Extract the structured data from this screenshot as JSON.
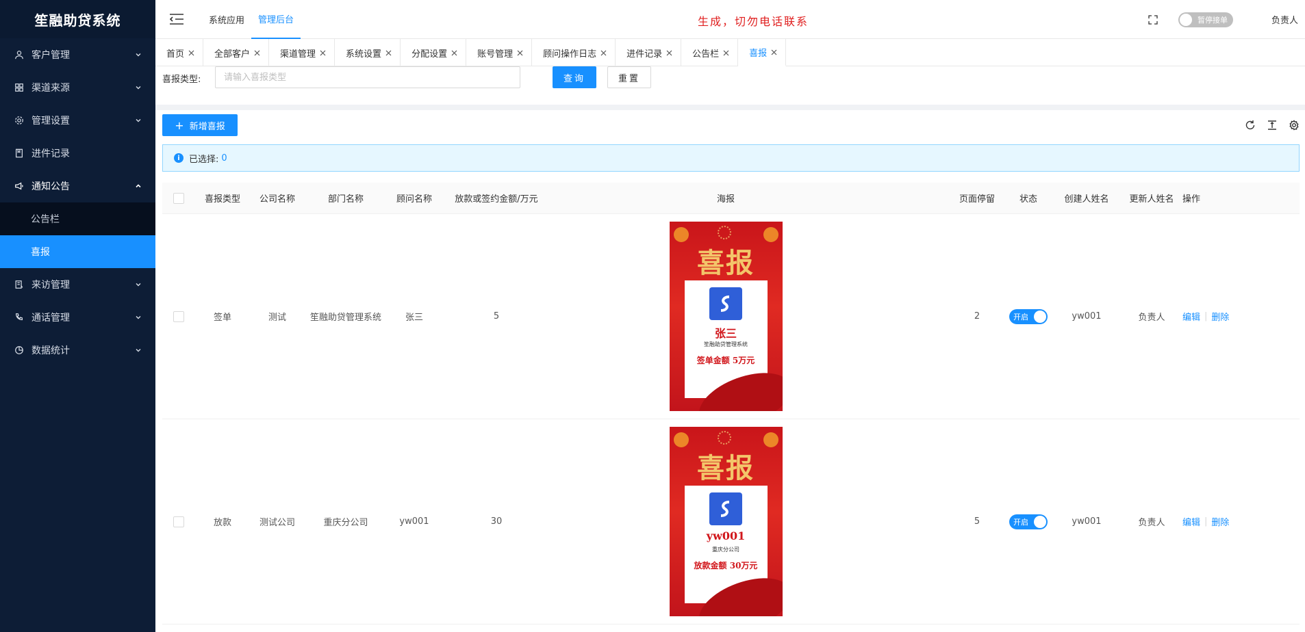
{
  "app": {
    "title": "笙融助贷系统"
  },
  "sidebar": {
    "items": [
      {
        "label": "客户管理",
        "icon": "user-icon",
        "expandable": true
      },
      {
        "label": "渠道来源",
        "icon": "grid-icon",
        "expandable": true
      },
      {
        "label": "管理设置",
        "icon": "gear-icon",
        "expandable": true
      },
      {
        "label": "进件记录",
        "icon": "document-icon",
        "expandable": false
      },
      {
        "label": "通知公告",
        "icon": "megaphone-icon",
        "expandable": true,
        "open": true,
        "children": [
          {
            "label": "公告栏"
          },
          {
            "label": "喜报",
            "active": true
          }
        ]
      },
      {
        "label": "来访管理",
        "icon": "visit-icon",
        "expandable": true
      },
      {
        "label": "通话管理",
        "icon": "phone-icon",
        "expandable": true
      },
      {
        "label": "数据统计",
        "icon": "pie-chart-icon",
        "expandable": true
      }
    ]
  },
  "header": {
    "nav": [
      {
        "label": "系统应用"
      },
      {
        "label": "管理后台",
        "active": true
      }
    ],
    "notice": "生成，切勿电话联系",
    "pause_toggle_label": "暂停接单",
    "user": "负责人"
  },
  "tabs": [
    {
      "label": "首页"
    },
    {
      "label": "全部客户"
    },
    {
      "label": "渠道管理"
    },
    {
      "label": "系统设置"
    },
    {
      "label": "分配设置"
    },
    {
      "label": "账号管理"
    },
    {
      "label": "顾问操作日志"
    },
    {
      "label": "进件记录"
    },
    {
      "label": "公告栏"
    },
    {
      "label": "喜报",
      "active": true
    }
  ],
  "search": {
    "label": "喜报类型:",
    "placeholder": "请输入喜报类型",
    "query_label": "查询",
    "reset_label": "重置"
  },
  "toolbar": {
    "add_label": "新增喜报"
  },
  "selection": {
    "label": "已选择:",
    "count": "0"
  },
  "table": {
    "columns": [
      "喜报类型",
      "公司名称",
      "部门名称",
      "顾问名称",
      "放款或签约金额/万元",
      "海报",
      "页面停留",
      "状态",
      "创建人姓名",
      "更新人姓名",
      "操作"
    ],
    "rows": [
      {
        "type": "签单",
        "company": "测试",
        "department": "笙融助贷管理系统",
        "advisor": "张三",
        "amount": "5",
        "poster": {
          "title": "喜报",
          "name": "张三",
          "company": "笙融助贷管理系统",
          "amount_text": "签单金额  5万元"
        },
        "stay": "2",
        "status": "开启",
        "creator": "yw001",
        "updater": "负责人",
        "edit": "编辑",
        "delete": "删除"
      },
      {
        "type": "放款",
        "company": "测试公司",
        "department": "重庆分公司",
        "advisor": "yw001",
        "amount": "30",
        "poster": {
          "title": "喜报",
          "name": "yw001",
          "company": "重庆分公司",
          "amount_text": "放款金额  30万元"
        },
        "stay": "5",
        "status": "开启",
        "creator": "yw001",
        "updater": "负责人",
        "edit": "编辑",
        "delete": "删除"
      }
    ]
  },
  "colors": {
    "sidebar_bg": "#0d1d36",
    "accent": "#1890ff",
    "notice": "#e02020",
    "poster_red": "#c9151a"
  }
}
